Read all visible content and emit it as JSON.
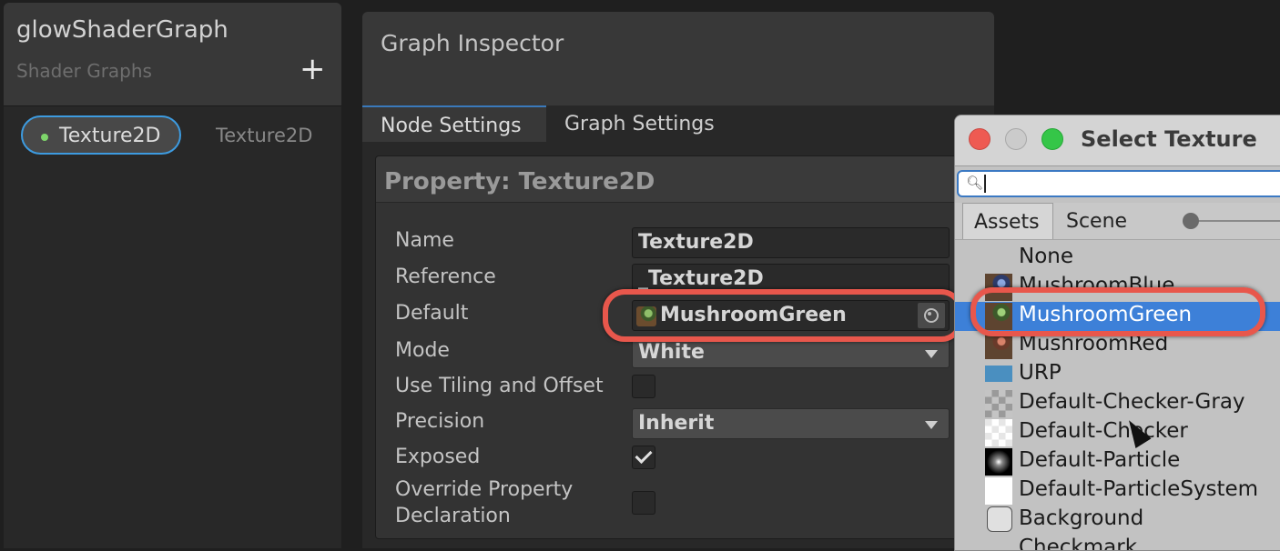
{
  "blackboard": {
    "title": "glowShaderGraph",
    "subtitle": "Shader Graphs",
    "add_label": "+",
    "property": {
      "name": "Texture2D",
      "type": "Texture2D"
    }
  },
  "inspector": {
    "title": "Graph Inspector",
    "tabs": [
      "Node Settings",
      "Graph Settings"
    ],
    "property_header": "Property: Texture2D",
    "fields": {
      "name_label": "Name",
      "name_value": "Texture2D",
      "reference_label": "Reference",
      "reference_value": "_Texture2D",
      "default_label": "Default",
      "default_value": "MushroomGreen",
      "mode_label": "Mode",
      "mode_value": "White",
      "tiling_label": "Use Tiling and Offset",
      "tiling_checked": false,
      "precision_label": "Precision",
      "precision_value": "Inherit",
      "exposed_label": "Exposed",
      "exposed_checked": true,
      "override_label_1": "Override Property",
      "override_label_2": "Declaration",
      "override_checked": false
    }
  },
  "select_texture": {
    "title": "Select Texture",
    "search_icon": "search-icon",
    "search_value": "",
    "tabs": [
      "Assets",
      "Scene"
    ],
    "items": [
      {
        "label": "None",
        "icon": "none"
      },
      {
        "label": "MushroomBlue",
        "icon": "mushroom-blue-thumb"
      },
      {
        "label": "MushroomGreen",
        "icon": "mushroom-green-thumb",
        "selected": true
      },
      {
        "label": "MushroomRed",
        "icon": "mushroom-red-thumb"
      },
      {
        "label": "URP",
        "icon": "urp-thumb"
      },
      {
        "label": "Default-Checker-Gray",
        "icon": "checker-gray-thumb"
      },
      {
        "label": "Default-Checker",
        "icon": "checker-thumb"
      },
      {
        "label": "Default-Particle",
        "icon": "particle-thumb"
      },
      {
        "label": "Default-ParticleSystem",
        "icon": "particle-system-thumb"
      },
      {
        "label": "Background",
        "icon": "background-thumb"
      },
      {
        "label": "Checkmark",
        "icon": "checkmark-thumb"
      }
    ]
  },
  "colors": {
    "accent_blue": "#3d80d8",
    "callout_red": "#e8574c",
    "focus_blue": "#3d9be0",
    "dot_green": "#7ed56b"
  }
}
